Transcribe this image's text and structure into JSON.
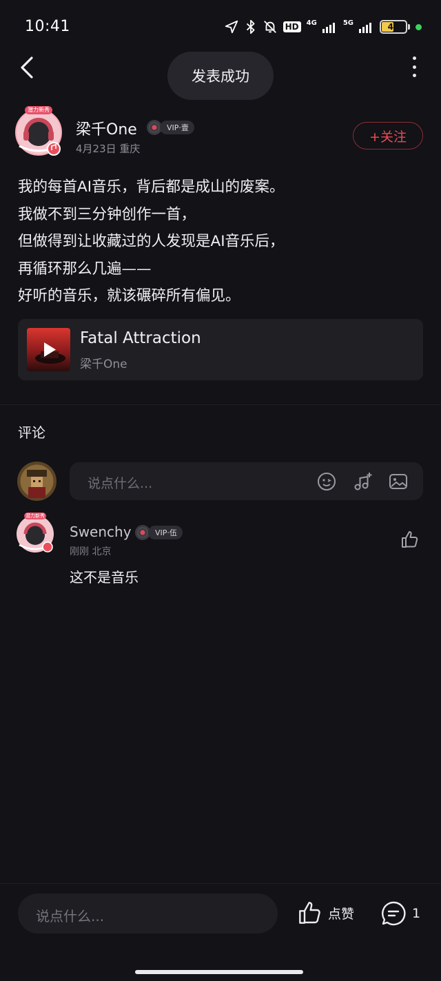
{
  "status_bar": {
    "time": "10:41",
    "hd": "HD",
    "net1": "4G",
    "net2": "5G",
    "battery": "48",
    "battery_level": 0.48,
    "icons": [
      "location-icon",
      "bluetooth-icon",
      "bell-off-icon",
      "signal-icon",
      "signal-icon",
      "battery-icon"
    ]
  },
  "nav": {
    "toast": "发表成功"
  },
  "post": {
    "author": {
      "name": "梁千One",
      "vip": "VIP·壹",
      "meta": "4月23日 重庆",
      "avatar_badge": "潜力新秀"
    },
    "follow_label": "+关注",
    "lines": [
      "我的每首AI音乐，背后都是成山的废案。",
      "我做不到三分钟创作一首，",
      "但做得到让收藏过的人发现是AI音乐后，",
      "再循环那么几遍——",
      "好听的音乐，就该碾碎所有偏见。"
    ],
    "song": {
      "title": "Fatal Attraction",
      "artist": "梁千One"
    }
  },
  "comments": {
    "title": "评论",
    "input_placeholder": "说点什么...",
    "items": [
      {
        "user": "Swenchy",
        "vip": "VIP·伍",
        "meta": "刚刚 北京",
        "text": "这不是音乐"
      }
    ]
  },
  "bottom_bar": {
    "input_placeholder": "说点什么...",
    "like_label": "点赞",
    "comment_count": "1"
  },
  "colors": {
    "background": "#121217",
    "accent_red": "#ef4a52",
    "card": "#1f1f24"
  }
}
